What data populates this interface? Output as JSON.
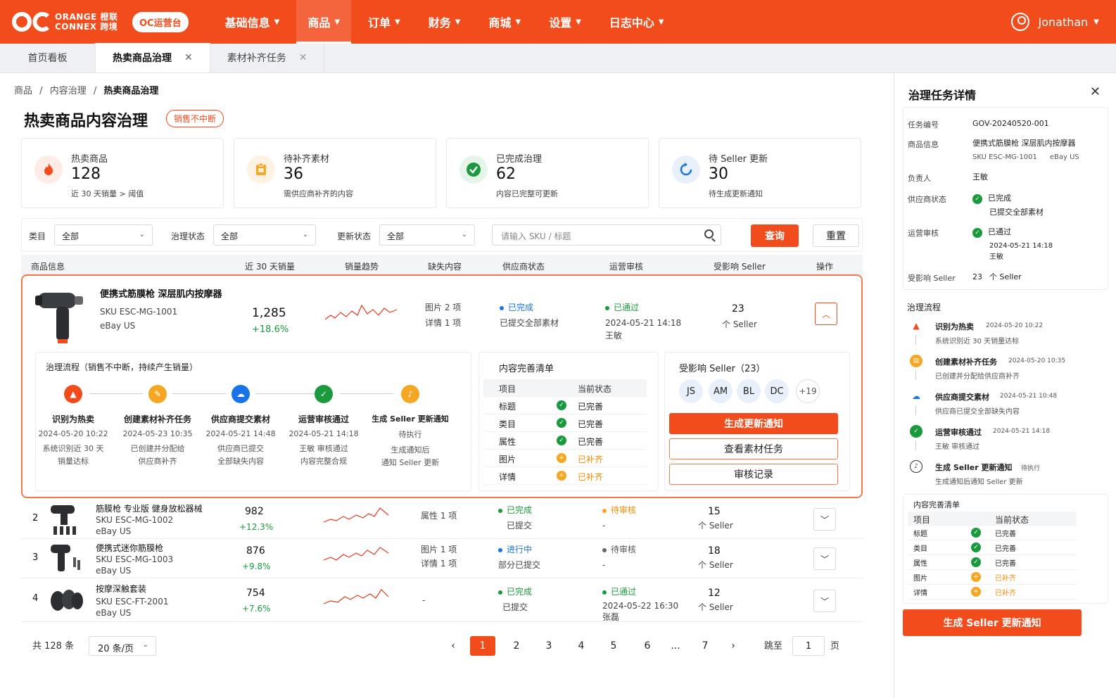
{
  "brand": {
    "logo_line1": "ORANGE 橙联",
    "logo_line2": "CONNEX 跨境",
    "badge": "OC运营台"
  },
  "nav": [
    "基础信息",
    "商品",
    "订单",
    "财务",
    "商城",
    "设置",
    "日志中心"
  ],
  "user": {
    "name": "Jonathan"
  },
  "tabs": [
    {
      "label": "首页看板"
    },
    {
      "label": "热卖商品治理"
    },
    {
      "label": "素材补齐任务"
    }
  ],
  "breadcrumb": [
    "商品",
    "内容治理",
    "热卖商品治理"
  ],
  "page": {
    "title": "热卖商品内容治理",
    "badge": "销售不中断"
  },
  "stats": [
    {
      "label": "热卖商品",
      "value": "128",
      "sub": "近 30 天销量 > 阈值",
      "icon": "fire-icon",
      "color": "#f24b1c"
    },
    {
      "label": "待补齐素材",
      "value": "36",
      "sub": "需供应商补齐的内容",
      "icon": "clipboard-icon",
      "color": "#f5a623"
    },
    {
      "label": "已完成治理",
      "value": "62",
      "sub": "内容已完整可更新",
      "icon": "check-icon",
      "color": "#1a9a3c"
    },
    {
      "label": "待 Seller 更新",
      "value": "30",
      "sub": "待生成更新通知",
      "icon": "refresh-icon",
      "color": "#1a73e8"
    }
  ],
  "filters": {
    "category_label": "类目",
    "category_value": "全部",
    "gov_label": "治理状态",
    "gov_value": "全部",
    "update_label": "更新状态",
    "update_value": "全部",
    "search_placeholder": "请输入 SKU / 标题",
    "query": "查询",
    "reset": "重置"
  },
  "columns": [
    "商品信息",
    "近 30 天销量",
    "销量趋势",
    "缺失内容",
    "供应商状态",
    "运营审核",
    "受影响 Seller",
    "操作"
  ],
  "expanded": {
    "name": "便携式筋膜枪 深层肌内按摩器",
    "sku": "SKU ESC-MG-1001",
    "store": "eBay US",
    "sales": "1,285",
    "growth": "+18.6%",
    "missing1": "图片 2 项",
    "missing2": "详情 1 项",
    "supplier_status": "已完成",
    "supplier_sub": "已提交全部素材",
    "review_status": "已通过",
    "review_time": "2024-05-21 14:18",
    "review_by": "王敏",
    "affected": "23",
    "affected_unit": "个 Seller",
    "flow_title": "治理流程（销售不中断，持续产生销量）",
    "steps": [
      {
        "name": "识别为热卖",
        "time": "2024-05-20 10:22",
        "d1": "系统识别近 30 天",
        "d2": "销量达标"
      },
      {
        "name": "创建素材补齐任务",
        "time": "2024-05-23 10:35",
        "d1": "已创建并分配给",
        "d2": "供应商补齐"
      },
      {
        "name": "供应商提交素材",
        "time": "2024-05-21 14:48",
        "d1": "供应商已提交",
        "d2": "全部缺失内容"
      },
      {
        "name": "运营审核通过",
        "time": "2024-05-21 14:18",
        "d1": "王敏 审核通过",
        "d2": "内容完整合规"
      },
      {
        "name": "生成 Seller 更新通知",
        "time": "待执行",
        "d1": "生成通知后",
        "d2": "通知 Seller 更新"
      }
    ],
    "checklist_title": "内容完善清单",
    "checklist_head": [
      "项目",
      "当前状态"
    ],
    "checklist": [
      {
        "item": "标题",
        "status": "已完善",
        "ok": true
      },
      {
        "item": "类目",
        "status": "已完善",
        "ok": true
      },
      {
        "item": "属性",
        "status": "已完善",
        "ok": true
      },
      {
        "item": "图片",
        "status": "已补齐",
        "ok": false
      },
      {
        "item": "详情",
        "status": "已补齐",
        "ok": false
      }
    ],
    "sellers_title": "受影响 Seller（23）",
    "avatars": [
      "JS",
      "AM",
      "BL",
      "DC",
      "+19"
    ],
    "btn_notify": "生成更新通知",
    "btn_task": "查看素材任务",
    "btn_audit": "审核记录"
  },
  "rows": [
    {
      "idx": "2",
      "name": "筋膜枪 专业版 健身放松器械",
      "sku": "SKU ESC-MG-1002",
      "store": "eBay US",
      "sales": "982",
      "growth": "+12.3%",
      "m1": "属性 1 项",
      "m2": "",
      "sup": "已完成",
      "sup_sub": "已提交",
      "rev": "待审核",
      "rev_sub": "-",
      "rev_sub2": "",
      "aff": "15",
      "aff_unit": "个 Seller"
    },
    {
      "idx": "3",
      "name": "便携式迷你筋膜枪",
      "sku": "SKU ESC-MG-1003",
      "store": "eBay US",
      "sales": "876",
      "growth": "+9.8%",
      "m1": "图片 1 项",
      "m2": "详情 1 项",
      "sup": "进行中",
      "sup_sub": "部分已提交",
      "rev": "待审核",
      "rev_sub": "-",
      "rev_sub2": "",
      "aff": "18",
      "aff_unit": "个 Seller"
    },
    {
      "idx": "4",
      "name": "按摩深触套装",
      "sku": "SKU ESC-FT-2001",
      "store": "eBay US",
      "sales": "754",
      "growth": "+7.6%",
      "m1": "-",
      "m2": "",
      "sup": "已完成",
      "sup_sub": "已提交",
      "rev": "已通过",
      "rev_sub": "2024-05-22 16:30",
      "rev_sub2": "张磊",
      "aff": "12",
      "aff_unit": "个 Seller"
    }
  ],
  "pager": {
    "total": "共 128 条",
    "size": "20 条/页",
    "pages": [
      "1",
      "2",
      "3",
      "4",
      "5",
      "6",
      "...",
      "7"
    ],
    "jump": "跳至",
    "jump_value": "1",
    "page_unit": "页"
  },
  "drawer": {
    "title": "治理任务详情",
    "task_no_label": "任务编号",
    "task_no": "GOV-20240520-001",
    "product_label": "商品信息",
    "product": "便携式筋膜枪 深层肌内按摩器",
    "product_sku": "SKU ESC-MG-1001",
    "product_store": "eBay US",
    "owner_label": "负责人",
    "owner": "王敏",
    "supplier_label": "供应商状态",
    "supplier": "已完成",
    "supplier_sub": "已提交全部素材",
    "review_label": "运营审核",
    "review": "已通过",
    "review_time": "2024-05-21 14:18",
    "review_by": "王敏",
    "affected_label": "受影响 Seller",
    "affected": "23",
    "affected_unit": "个 Seller",
    "flow_title": "治理流程",
    "flow": [
      {
        "name": "识别为热卖",
        "time": "2024-05-20 10:22",
        "desc": "系统识别近 30 天销量达标"
      },
      {
        "name": "创建素材补齐任务",
        "time": "2024-05-20 10:35",
        "desc": "已创建并分配给供应商补齐"
      },
      {
        "name": "供应商提交素材",
        "time": "2024-05-21 10:48",
        "desc": "供应商已提交全部缺失内容"
      },
      {
        "name": "运营审核通过",
        "time": "2024-05-21 14:18",
        "desc": "王敏 审核通过"
      },
      {
        "name": "生成 Seller 更新通知",
        "time": "待执行",
        "desc": "生成通知后通知 Seller 更新"
      }
    ],
    "checklist_title": "内容完善清单",
    "btn": "生成 Seller 更新通知"
  },
  "colors": {
    "brand": "#f24b1c",
    "green": "#1a9a3c",
    "blue": "#1a73e8",
    "orange": "#f5a623"
  }
}
